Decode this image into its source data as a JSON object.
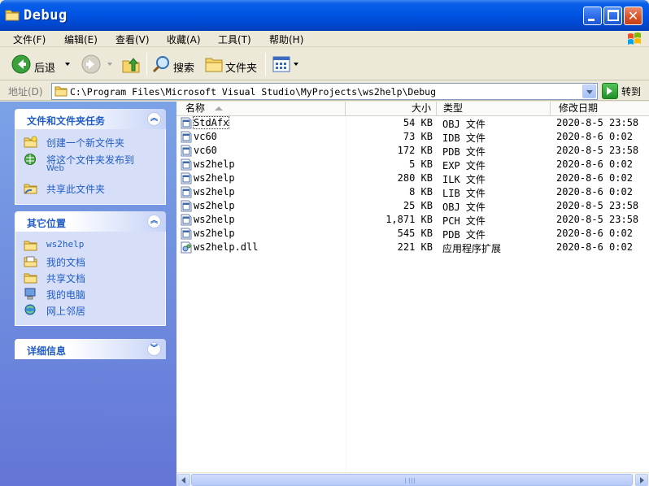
{
  "window": {
    "title": "Debug",
    "icon": "folder-icon",
    "controls": [
      "minimize-icon",
      "maximize-icon",
      "close-icon"
    ]
  },
  "menu": [
    {
      "label": "文件(F)"
    },
    {
      "label": "编辑(E)"
    },
    {
      "label": "查看(V)"
    },
    {
      "label": "收藏(A)"
    },
    {
      "label": "工具(T)"
    },
    {
      "label": "帮助(H)"
    }
  ],
  "toolbar": {
    "back_label": "后退",
    "search_label": "搜索",
    "folders_label": "文件夹"
  },
  "address": {
    "label": "地址(D)",
    "path": "C:\\Program Files\\Microsoft Visual Studio\\MyProjects\\ws2help\\Debug",
    "go_label": "转到"
  },
  "tasks_panel": {
    "title": "文件和文件夹任务",
    "items": [
      {
        "label": "创建一个新文件夹",
        "icon": "new-folder-icon"
      },
      {
        "label": "将这个文件夹发布到",
        "sub": "Web",
        "icon": "publish-web-icon"
      },
      {
        "label": "共享此文件夹",
        "icon": "share-folder-icon"
      }
    ]
  },
  "places_panel": {
    "title": "其它位置",
    "items": [
      {
        "label": "ws2help",
        "icon": "folder-icon"
      },
      {
        "label": "我的文档",
        "icon": "my-documents-icon"
      },
      {
        "label": "共享文档",
        "icon": "shared-folder-icon"
      },
      {
        "label": "我的电脑",
        "icon": "my-computer-icon"
      },
      {
        "label": "网上邻居",
        "icon": "network-icon"
      }
    ]
  },
  "details_panel": {
    "title": "详细信息"
  },
  "columns": {
    "name": "名称",
    "size": "大小",
    "type": "类型",
    "modified": "修改日期"
  },
  "files": [
    {
      "name": "StdAfx",
      "size": "54 KB",
      "type": "OBJ 文件",
      "modified": "2020-8-5 23:58",
      "icon": "file-icon"
    },
    {
      "name": "vc60",
      "size": "73 KB",
      "type": "IDB 文件",
      "modified": "2020-8-6 0:02",
      "icon": "file-icon"
    },
    {
      "name": "vc60",
      "size": "172 KB",
      "type": "PDB 文件",
      "modified": "2020-8-5 23:58",
      "icon": "file-icon"
    },
    {
      "name": "ws2help",
      "size": "5 KB",
      "type": "EXP 文件",
      "modified": "2020-8-6 0:02",
      "icon": "file-icon"
    },
    {
      "name": "ws2help",
      "size": "280 KB",
      "type": "ILK 文件",
      "modified": "2020-8-6 0:02",
      "icon": "file-icon"
    },
    {
      "name": "ws2help",
      "size": "8 KB",
      "type": "LIB 文件",
      "modified": "2020-8-6 0:02",
      "icon": "file-icon"
    },
    {
      "name": "ws2help",
      "size": "25 KB",
      "type": "OBJ 文件",
      "modified": "2020-8-5 23:58",
      "icon": "file-icon"
    },
    {
      "name": "ws2help",
      "size": "1,871 KB",
      "type": "PCH 文件",
      "modified": "2020-8-5 23:58",
      "icon": "file-icon"
    },
    {
      "name": "ws2help",
      "size": "545 KB",
      "type": "PDB 文件",
      "modified": "2020-8-6 0:02",
      "icon": "file-icon"
    },
    {
      "name": "ws2help.dll",
      "size": "221 KB",
      "type": "应用程序扩展",
      "modified": "2020-8-6 0:02",
      "icon": "dll-file-icon"
    }
  ]
}
